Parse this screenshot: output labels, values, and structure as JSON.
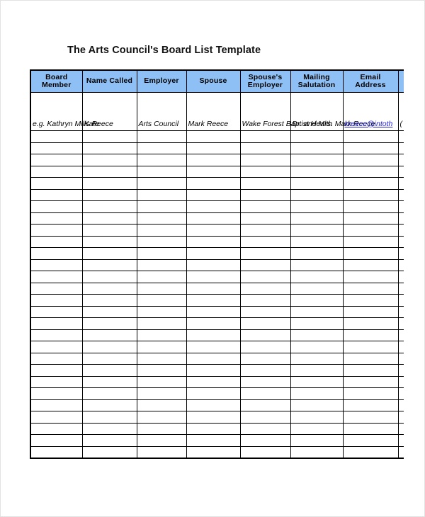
{
  "document": {
    "title": "The Arts Council's Board List Template"
  },
  "table": {
    "headers": [
      "Board Member",
      "Name Called",
      "Employer",
      "Spouse",
      "Spouse's Employer",
      "Mailing Salutation",
      "Email Address",
      ""
    ],
    "example_row": {
      "board_member": "e.g. Kathryn Mills Reece",
      "name_called": "Kate",
      "employer": "Arts Council",
      "spouse": "Mark Reece",
      "spouse_employer": "Wake Forest Baptist Health",
      "mailing_salutation": "Dr. and Mrs. Mark Reece",
      "email_address": "kreece@intoth",
      "overflow_column": "("
    },
    "empty_row_count": 28,
    "colors": {
      "header_background": "#8FC0F5",
      "border": "#000000",
      "link": "#2222cc",
      "page_background": "#ffffff",
      "page_border": "#e2e2e2"
    }
  }
}
